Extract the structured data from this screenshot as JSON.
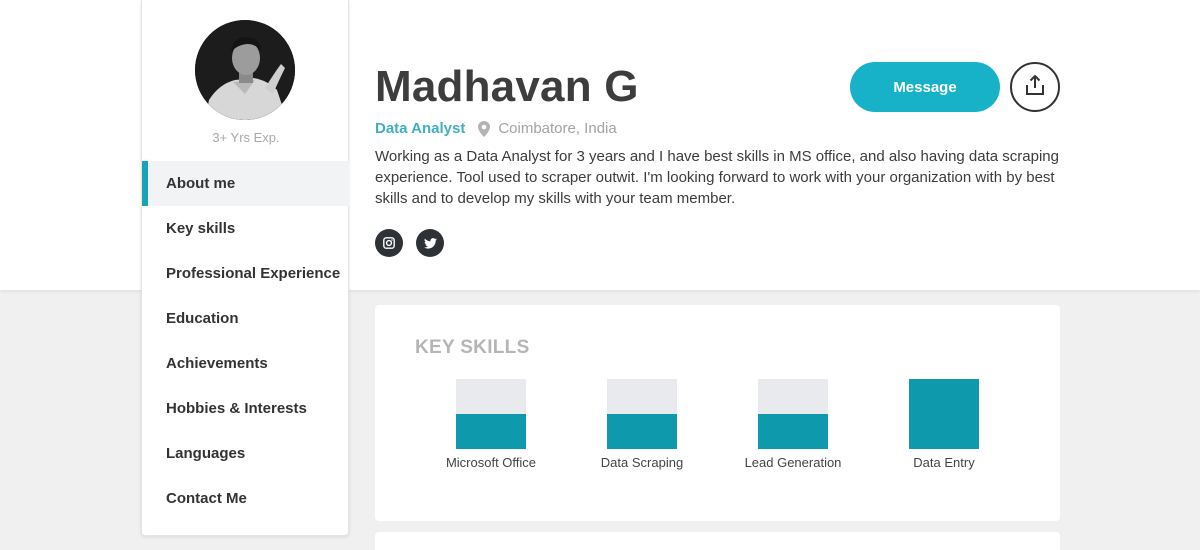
{
  "profile": {
    "name": "Madhavan G",
    "role": "Data Analyst",
    "location": "Coimbatore, India",
    "experience": "3+ Yrs Exp.",
    "bio": "Working as a Data Analyst for 3 years and I have best skills in MS office, and also having data scraping experience. Tool used to scraper outwit. I'm looking forward to work with your organization with by best skills and to develop my skills with your team member."
  },
  "actions": {
    "message_label": "Message",
    "share_icon": "share-icon"
  },
  "social": [
    {
      "icon": "instagram-icon"
    },
    {
      "icon": "twitter-icon"
    }
  ],
  "nav": {
    "items": [
      {
        "label": "About me",
        "active": true
      },
      {
        "label": "Key skills"
      },
      {
        "label": "Professional Experience"
      },
      {
        "label": "Education"
      },
      {
        "label": "Achievements"
      },
      {
        "label": "Hobbies & Interests"
      },
      {
        "label": "Languages"
      },
      {
        "label": "Contact Me"
      }
    ]
  },
  "skills": {
    "title": "KEY SKILLS",
    "items": [
      {
        "label": "Microsoft Office",
        "level": 0.5
      },
      {
        "label": "Data Scraping",
        "level": 0.5
      },
      {
        "label": "Lead Generation",
        "level": 0.5
      },
      {
        "label": "Data Entry",
        "level": 1.0
      }
    ]
  },
  "colors": {
    "accent": "#18b2c8",
    "skill_fill": "#0e99ac",
    "skill_track": "#e9eaee",
    "role": "#3fb0c2"
  }
}
